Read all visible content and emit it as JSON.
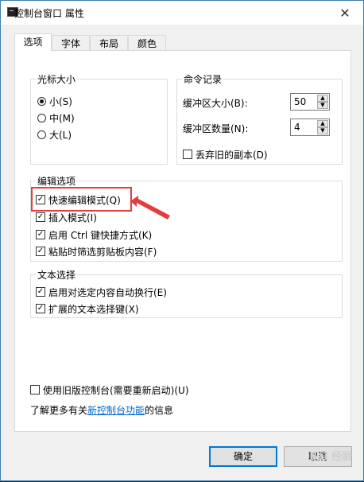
{
  "window": {
    "title": "控制台窗口 属性",
    "close_icon": "close-icon"
  },
  "tabs": [
    {
      "label": "选项",
      "active": true
    },
    {
      "label": "字体",
      "active": false
    },
    {
      "label": "布局",
      "active": false
    },
    {
      "label": "颜色",
      "active": false
    }
  ],
  "cursor_size": {
    "title": "光标大小",
    "options": [
      {
        "label": "小(S)",
        "selected": true
      },
      {
        "label": "中(M)",
        "selected": false
      },
      {
        "label": "大(L)",
        "selected": false
      }
    ]
  },
  "command_history": {
    "title": "命令记录",
    "buffer_size_label": "缓冲区大小(B):",
    "buffer_size_value": "50",
    "buffer_count_label": "缓冲区数量(N):",
    "buffer_count_value": "4",
    "discard_label": "丢弃旧的副本(D)",
    "discard_checked": false
  },
  "edit_options": {
    "title": "编辑选项",
    "items": [
      {
        "label": "快速编辑模式(Q)",
        "checked": true
      },
      {
        "label": "插入模式(I)",
        "checked": true
      },
      {
        "label": "启用 Ctrl 键快捷方式(K)",
        "checked": true
      },
      {
        "label": "粘贴时筛选剪贴板内容(F)",
        "checked": true
      }
    ]
  },
  "text_selection": {
    "title": "文本选择",
    "items": [
      {
        "label": "启用对选定内容自动换行(E)",
        "checked": true
      },
      {
        "label": "扩展的文本选择键(X)",
        "checked": true
      }
    ]
  },
  "legacy": {
    "label": "使用旧版控制台(需要重新启动)(U)",
    "checked": false
  },
  "learn_more": {
    "prefix": "了解更多有关",
    "link": "新控制台功能",
    "suffix": "的信息"
  },
  "buttons": {
    "ok": "确定",
    "cancel": "取消"
  },
  "annotation": {
    "color": "#e53c3c"
  }
}
